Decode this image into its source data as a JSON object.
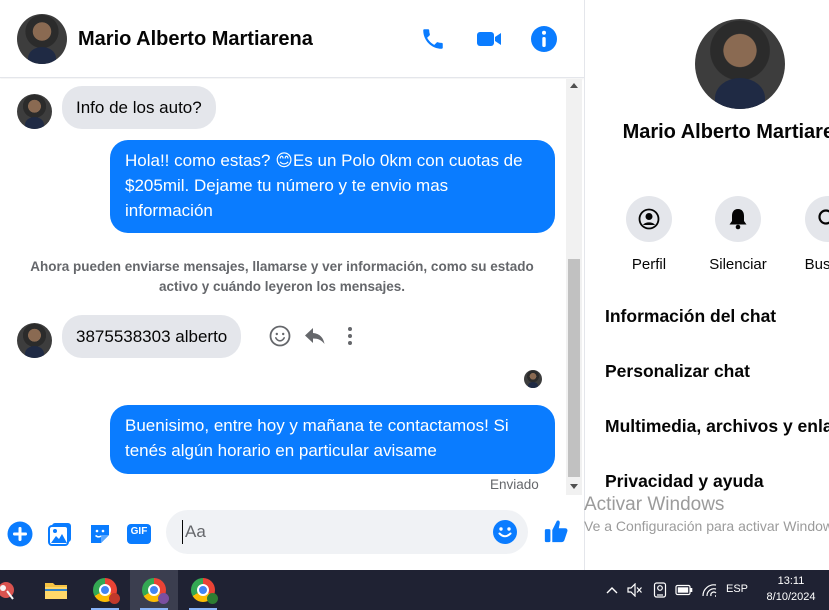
{
  "header": {
    "name": "Mario Alberto Martiarena",
    "icons": [
      "phone-icon",
      "video-icon",
      "info-icon"
    ]
  },
  "messages": {
    "incoming_1": "Info de los auto?",
    "outgoing_1": "Hola!! como estas? 😊Es un Polo 0km con cuotas de $205mil. Dejame tu número y te envio mas información",
    "system": "Ahora pueden enviarse mensajes, llamarse y ver información, como su estado activo y cuándo leyeron los mensajes.",
    "incoming_2": "3875538303 alberto",
    "outgoing_2": "Buenisimo, entre hoy y mañana te contactamos! Si tenés algún horario en particular avisame",
    "sent_status": "Enviado"
  },
  "composer": {
    "placeholder": "Aa",
    "gif_label": "GIF",
    "icons": [
      "add-icon",
      "image-icon",
      "sticker-icon",
      "gif-icon",
      "emoji-icon",
      "like-icon"
    ]
  },
  "right_panel": {
    "name": "Mario Alberto Martiarena",
    "actions": [
      {
        "label": "Perfil",
        "icon": "profile-icon"
      },
      {
        "label": "Silenciar",
        "icon": "bell-icon"
      },
      {
        "label": "Buscar",
        "icon": "search-icon"
      }
    ],
    "items": [
      "Información del chat",
      "Personalizar chat",
      "Multimedia, archivos y enlaces",
      "Privacidad y ayuda"
    ]
  },
  "watermark": {
    "title": "Activar Windows",
    "subtitle": "Ve a Configuración para activar Windows."
  },
  "taskbar": {
    "language": "ESP",
    "time": "13:11",
    "date": "8/10/2024"
  },
  "colors": {
    "accent": "#0a7cff",
    "incoming_bubble": "#e4e6eb",
    "taskbar": "#1f2233"
  }
}
